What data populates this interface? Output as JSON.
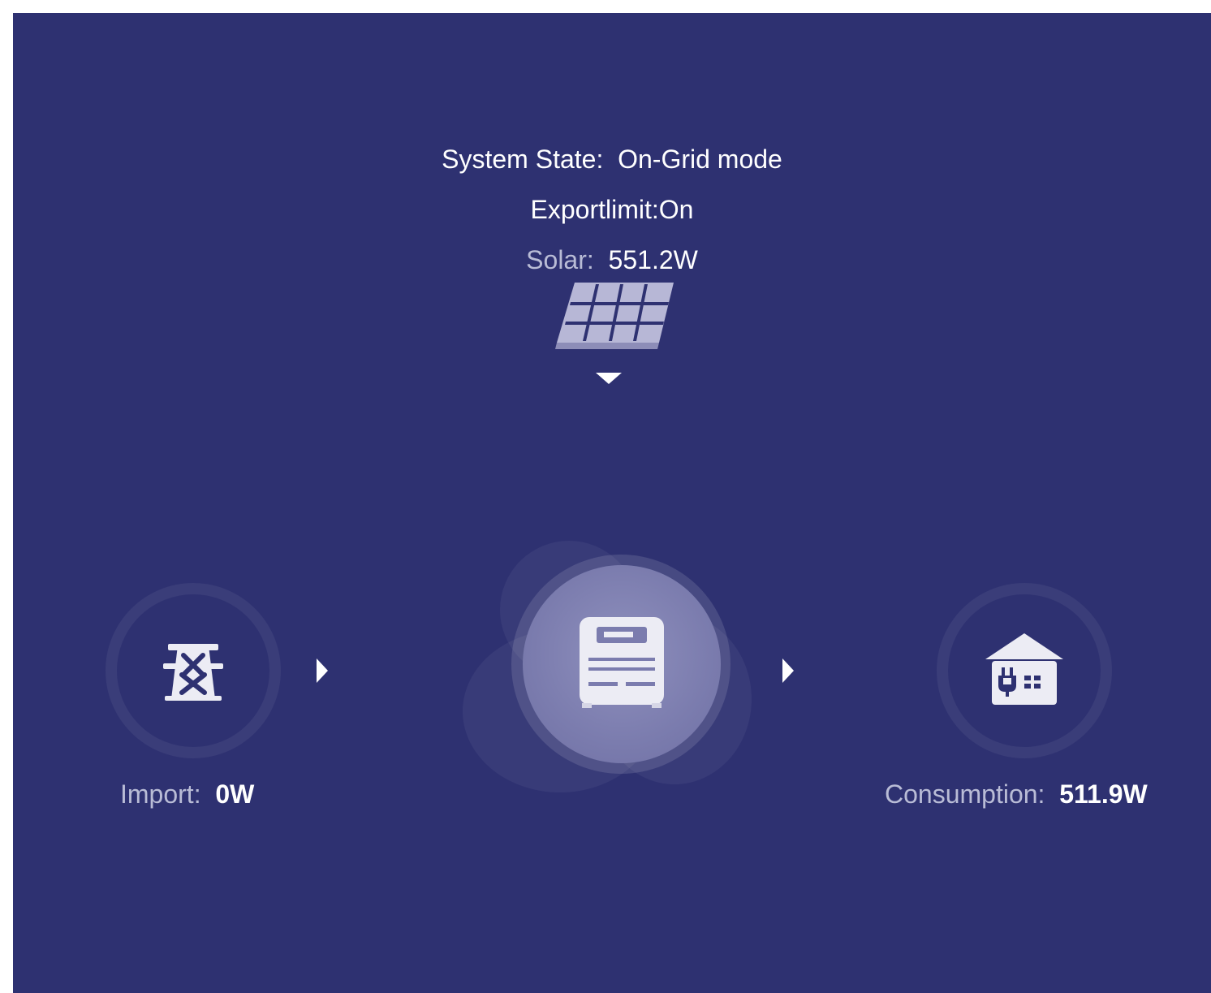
{
  "status": {
    "system_state_label": "System State:",
    "system_state_value": "On-Grid mode",
    "export_limit": "Exportlimit:On",
    "solar_label": "Solar:",
    "solar_value": "551.2W"
  },
  "grid": {
    "label": "Import:",
    "value": "0W",
    "icon": "transmission-tower-icon"
  },
  "inverter": {
    "icon": "inverter-icon"
  },
  "load": {
    "label": "Consumption:",
    "value": "511.9W",
    "icon": "house-plug-icon"
  },
  "flow": {
    "solar_to_inverter": "down",
    "grid_to_inverter": "right",
    "inverter_to_load": "right"
  },
  "colors": {
    "background": "#2e3171",
    "text": "#ffffff",
    "label_muted": "#b9bcd6",
    "icon_fill": "#e9e9f3"
  }
}
